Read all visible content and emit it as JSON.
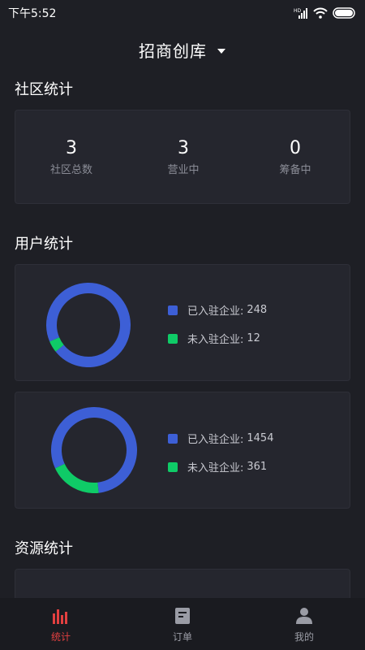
{
  "status_bar": {
    "time": "下午5:52"
  },
  "header": {
    "title": "招商创库"
  },
  "community": {
    "title": "社区统计",
    "stats": [
      {
        "value": "3",
        "label": "社区总数"
      },
      {
        "value": "3",
        "label": "营业中"
      },
      {
        "value": "0",
        "label": "筹备中"
      }
    ]
  },
  "users": {
    "title": "用户统计",
    "cards": [
      {
        "legend": [
          {
            "label": "已入驻企业:",
            "value": "248",
            "color": "#3d5fd6"
          },
          {
            "label": "未入驻企业:",
            "value": "12",
            "color": "#0fcb67"
          }
        ]
      },
      {
        "legend": [
          {
            "label": "已入驻企业:",
            "value": "1454",
            "color": "#3d5fd6"
          },
          {
            "label": "未入驻企业:",
            "value": "361",
            "color": "#0fcb67"
          }
        ]
      }
    ]
  },
  "resources": {
    "title": "资源统计"
  },
  "nav": {
    "items": [
      {
        "label": "统计",
        "icon": "bar-chart-icon",
        "active": true
      },
      {
        "label": "订单",
        "icon": "document-icon",
        "active": false
      },
      {
        "label": "我的",
        "icon": "person-icon",
        "active": false
      }
    ]
  },
  "colors": {
    "background": "#1e1f25",
    "card": "#25262e",
    "blue": "#3d5fd6",
    "green": "#0fcb67",
    "active_nav": "#e34040"
  }
}
